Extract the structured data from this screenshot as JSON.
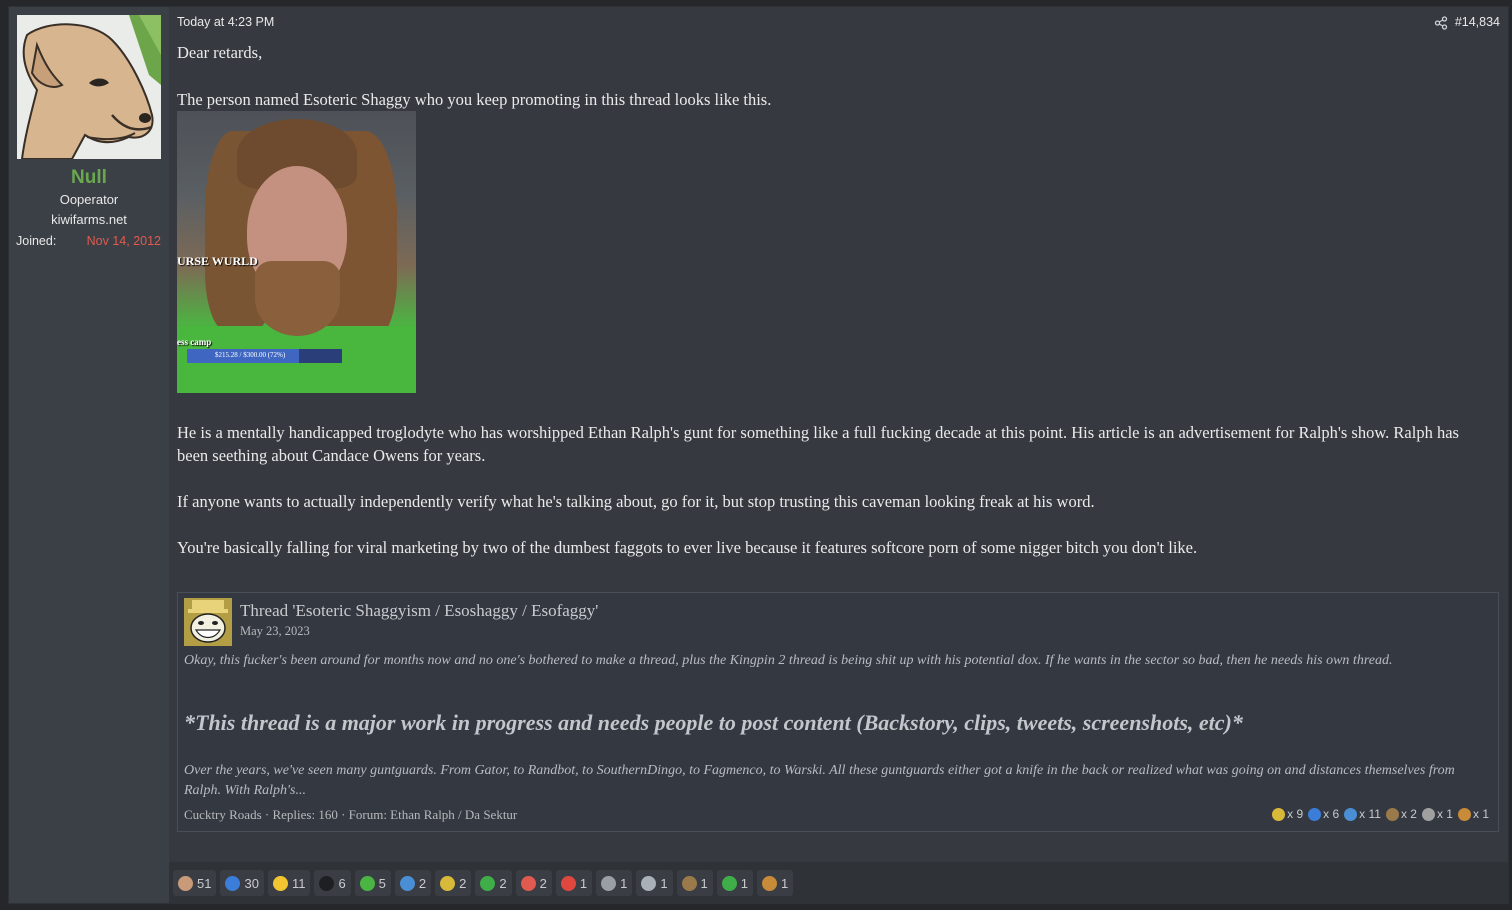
{
  "author": {
    "name": "Null",
    "title": "Ooperator",
    "site": "kiwifarms.net",
    "joined_label": "Joined:",
    "joined_value": "Nov 14, 2012"
  },
  "post": {
    "time": "Today at 4:23 PM",
    "number": "#14,834",
    "share_icon": "share-icon",
    "paragraphs": [
      "Dear retards,",
      "The person named Esoteric Shaggy who you keep promoting in this thread looks like this.",
      "He is a mentally handicapped troglodyte who has worshipped Ethan Ralph's gunt for something like a full fucking decade at this point. His article is an advertisement for Ralph's show. Ralph has been seething about Candace Owens for years.",
      "If anyone wants to actually independently verify what he's talking about, go for it, but stop trusting this caveman looking freak at his word.",
      "You're basically falling for viral marketing by two of the dumbest faggots to ever live because it features softcore porn of some nigger bitch you don't like."
    ],
    "image_overlay": {
      "title_text": "URSE WURLD",
      "camp_text": "ess camp",
      "progress_text": "$215.28 / $300.00 (72%)",
      "progress_fraction": 0.72
    }
  },
  "embed": {
    "title": "Thread 'Esoteric Shaggyism / Esoshaggy / Esofaggy'",
    "date": "May 23, 2023",
    "snippet1": "Okay, this fucker's been around for months now and no one's bothered to make a thread, plus the Kingpin 2 thread is being shit up with his potential dox. If he wants in the sector so bad, then he needs his own thread.",
    "heading": "*This thread is a major work in progress and needs people to post content (Backstory, clips, tweets, screenshots, etc)*",
    "snippet2": "Over the years, we've seen many guntguards. From Gator, to Randbot, to SouthernDingo, to Fagmenco, to Warski. All these guntguards either got a knife in the back or realized what was going on and distances themselves from Ralph. With Ralph's...",
    "meta": "Cucktry Roads · Replies: 160 · Forum: Ethan Ralph / Da Sektur",
    "reactions": [
      {
        "icon": "pineapple-icon",
        "color": "#d8b93a",
        "count": "x 9"
      },
      {
        "icon": "info-icon",
        "color": "#3b7dd8",
        "count": "x 6"
      },
      {
        "icon": "thumbs-up-icon",
        "color": "#4a8fd6",
        "count": "x 11"
      },
      {
        "icon": "cowboy-icon",
        "color": "#9a7a4a",
        "count": "x 2"
      },
      {
        "icon": "wand-icon",
        "color": "#a0a0a0",
        "count": "x 1"
      },
      {
        "icon": "puzzle-icon",
        "color": "#c78b3a",
        "count": "x 1"
      }
    ]
  },
  "reactions": [
    {
      "icon": "face-icon",
      "color": "#c89a7a",
      "count": "51"
    },
    {
      "icon": "info-icon",
      "color": "#3b7dd8",
      "count": "30"
    },
    {
      "icon": "thinking-icon",
      "color": "#f2c531",
      "count": "11"
    },
    {
      "icon": "top-hat-icon",
      "color": "#1d1f23",
      "count": "6"
    },
    {
      "icon": "cocktail-icon",
      "color": "#4bb543",
      "count": "5"
    },
    {
      "icon": "thumbs-up-icon",
      "color": "#4a8fd6",
      "count": "2"
    },
    {
      "icon": "pineapple-icon",
      "color": "#d8b93a",
      "count": "2"
    },
    {
      "icon": "check-icon",
      "color": "#3fae49",
      "count": "2"
    },
    {
      "icon": "rainbow-icon",
      "color": "#e05a4f",
      "count": "2"
    },
    {
      "icon": "alarm-clock-icon",
      "color": "#e0483f",
      "count": "1"
    },
    {
      "icon": "tombstone-icon",
      "color": "#9a9ea5",
      "count": "1"
    },
    {
      "icon": "speech-icon",
      "color": "#aab0b8",
      "count": "1"
    },
    {
      "icon": "cowboy-icon",
      "color": "#9a7a4a",
      "count": "1"
    },
    {
      "icon": "handshake-icon",
      "color": "#3fae49",
      "count": "1"
    },
    {
      "icon": "puzzle-icon",
      "color": "#c78b3a",
      "count": "1"
    }
  ]
}
